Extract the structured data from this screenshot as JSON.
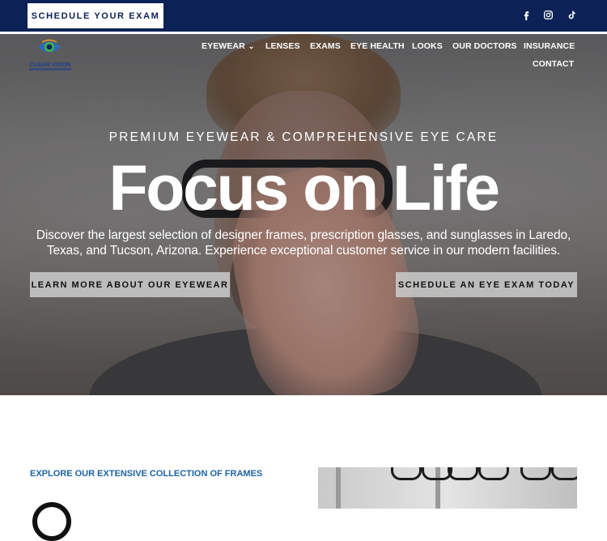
{
  "topbar": {
    "schedule_label": "SCHEDULE YOUR EXAM",
    "background_color": "#0c2257",
    "social": [
      {
        "icon": "facebook-icon"
      },
      {
        "icon": "instagram-icon"
      },
      {
        "icon": "tiktok-icon"
      }
    ]
  },
  "logo": {
    "text": "CLEAR VISION"
  },
  "nav": {
    "items": [
      {
        "label": "EYEWEAR",
        "has_dropdown": true
      },
      {
        "label": "LENSES"
      },
      {
        "label": "EXAMS"
      },
      {
        "label": "EYE HEALTH"
      },
      {
        "label": "LOOKS"
      },
      {
        "label": "OUR DOCTORS"
      },
      {
        "label": "INSURANCE"
      },
      {
        "label": "CONTACT"
      }
    ]
  },
  "hero": {
    "eyebrow": "PREMIUM EYEWEAR & COMPREHENSIVE EYE CARE",
    "headline": "Focus on Life",
    "subtext": "Discover the largest selection of designer frames, prescription glasses, and sunglasses in Laredo, Texas, and Tucson, Arizona. Experience exceptional customer service in our modern facilities.",
    "primary_button": "LEARN MORE ABOUT OUR EYEWEAR",
    "secondary_button": "SCHEDULE AN EYE EXAM TODAY"
  },
  "collection": {
    "label": "EXPLORE OUR EXTENSIVE COLLECTION OF FRAMES",
    "accent_color": "#1d63a7"
  }
}
